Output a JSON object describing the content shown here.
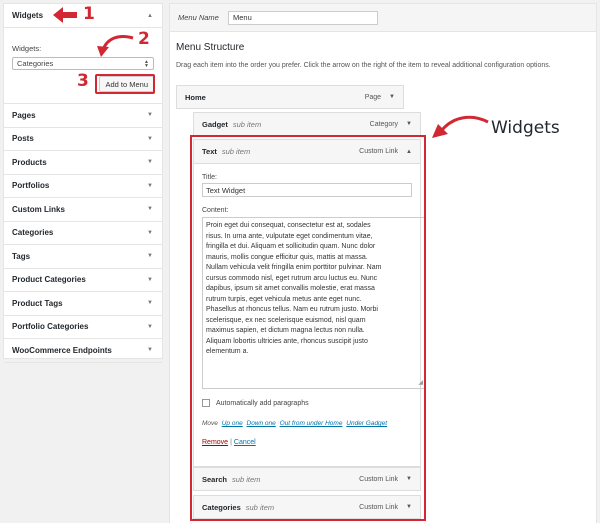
{
  "left_panel": {
    "widgets_section": {
      "title": "Widgets",
      "arrow": "▲",
      "widgets_label": "Widgets:",
      "selected_widget": "Categories",
      "add_button": "Add to Menu"
    },
    "sections": [
      {
        "label": "Pages"
      },
      {
        "label": "Posts"
      },
      {
        "label": "Products"
      },
      {
        "label": "Portfolios"
      },
      {
        "label": "Custom Links"
      },
      {
        "label": "Categories"
      },
      {
        "label": "Tags"
      },
      {
        "label": "Product Categories"
      },
      {
        "label": "Product Tags"
      },
      {
        "label": "Portfolio Categories"
      },
      {
        "label": "WooCommerce Endpoints"
      }
    ],
    "collapsed_arrow": "▼"
  },
  "annotations": {
    "step1": "1",
    "step2": "2",
    "step3": "3",
    "callout": "Widgets",
    "accent_color": "#d12833"
  },
  "menu_editor": {
    "menu_name_label": "Menu Name",
    "menu_name_value": "Menu",
    "structure_title": "Menu Structure",
    "structure_desc": "Drag each item into the order you prefer. Click the arrow on the right of the item to reveal additional configuration options.",
    "items": {
      "home": {
        "title": "Home",
        "type": "Page"
      },
      "gadget": {
        "title": "Gadget",
        "sub": "sub item",
        "type": "Category"
      },
      "text": {
        "title": "Text",
        "sub": "sub item",
        "type": "Custom Link"
      },
      "search": {
        "title": "Search",
        "sub": "sub item",
        "type": "Custom Link"
      },
      "categories": {
        "title": "Categories",
        "sub": "sub item",
        "type": "Custom Link"
      }
    },
    "text_widget": {
      "title_label": "Title:",
      "title_value": "Text Widget",
      "content_label": "Content:",
      "content_lines": [
        "Proin eget dui consequat, consectetur est at, sodales",
        "risus. In urna ante, vulputate eget condimentum vitae,",
        "fringilla et dui. Aliquam et sollicitudin quam. Nunc dolor",
        "mauris, mollis congue efficitur quis, mattis at massa.",
        "Nullam vehicula velit fringilla enim porttitor pulvinar. Nam",
        "cursus commodo nisl, eget rutrum arcu luctus eu. Nunc",
        "dapibus, ipsum sit amet convallis molestie, erat massa",
        "rutrum turpis, eget vehicula metus ante eget nunc.",
        "Phasellus at rhoncus tellus. Nam eu rutrum justo. Morbi",
        "scelerisque, ex nec scelerisque euismod, nisl quam",
        "maximus sapien, et dictum magna lectus non nulla.",
        "Aliquam lobortis ultricies ante, rhoncus suscipit justo",
        "elementum a."
      ],
      "auto_paragraphs": "Automatically add paragraphs",
      "move_label": "Move",
      "move_links": [
        "Up one",
        "Down one",
        "Out from under Home",
        "Under Gadget"
      ],
      "remove": "Remove",
      "separator": "|",
      "cancel": "Cancel"
    }
  }
}
